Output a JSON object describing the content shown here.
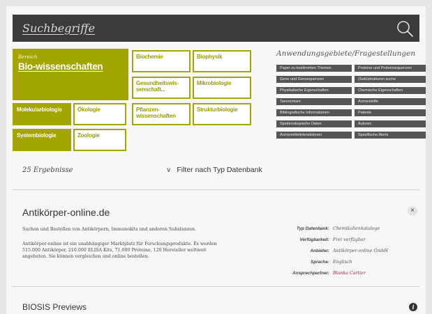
{
  "search": {
    "placeholder": "Suchbegriffe"
  },
  "icons": {
    "search": "search-icon",
    "close": "close-icon",
    "chevron": "chevron-down-icon",
    "info": "info-icon"
  },
  "colors": {
    "accent": "#a3a500",
    "dark": "#3b3b3b",
    "tag_bg": "#555555",
    "link": "#8a2b4a"
  },
  "areas": {
    "main": {
      "sub": "Bereich",
      "title": "Bio-wissenschaften"
    },
    "tiles": [
      {
        "label": "Biochemie"
      },
      {
        "label": "Biophysik"
      },
      {
        "label": "Gesundheitswis-senschaft..."
      },
      {
        "label": "Mikrobiologie"
      },
      {
        "label": "Molekularbiologie"
      },
      {
        "label": "Ökologie"
      },
      {
        "label": "Pflanzen-wissenschaften"
      },
      {
        "label": "Strukturbiologie"
      },
      {
        "label": "Systembiologie"
      },
      {
        "label": "Zoologie"
      }
    ]
  },
  "applications": {
    "heading": "Anwendungsgebiete/Fragestellungen",
    "tags": [
      "Paper zu bestimmten Themen",
      "Proteine und Proteinsequenzen",
      "Gene und Gensequenzen",
      "(Sub)strukturen suche",
      "Physikalische Eigenschaften",
      "Chemische Eigenschaften",
      "Taxonomien",
      "Arzneistoffe",
      "Bibliografische Informationen",
      "Patente",
      "Spektroskopische Daten",
      "Autoren",
      "Arzneimittelinteraktionen",
      "Spezifische Alerts"
    ]
  },
  "results": {
    "count": "25 Ergebnisse",
    "filter": "Filter nach Typ Datenbank"
  },
  "entry": {
    "title": "Antikörper-online.de",
    "summary": "Suchen und Bestellen von Antikörpern, Immunokits und anderen Substanzen.",
    "description": "Antikörper-online ist ein unabhängiger Marktplatz für Forschungsprodukte. Es werden 515.000 Antikörper, 210.000 ELISA Kits, 71.000 Proteine, 120 Hersteller weltweit angeboten. Sie können vergleichen und online bestellen.",
    "close": "×",
    "meta": [
      {
        "key": "Typ Datenbank:",
        "value": "Chemikalienkataloge"
      },
      {
        "key": "Verfügbarkeit:",
        "value": "Frei verfügbar"
      },
      {
        "key": "Anbieter:",
        "value": "Antikörper-online GmbH"
      },
      {
        "key": "Sprache:",
        "value": "Englisch"
      },
      {
        "key": "Ansprechpartner:",
        "value": "Blanka Cartier"
      }
    ]
  },
  "entry2": {
    "title": "BIOSIS Previews",
    "info": "i"
  }
}
